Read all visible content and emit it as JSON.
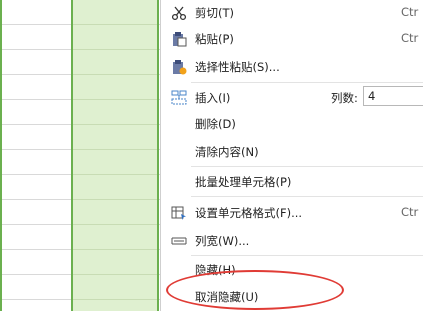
{
  "context_menu": {
    "items": [
      {
        "icon": "scissors-icon",
        "label": "剪切(T)",
        "shortcut": "Ctr"
      },
      {
        "icon": "paste-icon",
        "label": "粘贴(P)",
        "shortcut": "Ctr"
      },
      {
        "icon": "paste-special-icon",
        "label": "选择性粘贴(S)..."
      },
      {
        "icon": "insert-icon",
        "label": "插入(I)",
        "columns_label": "列数:",
        "columns_value": "4"
      },
      {
        "label": "删除(D)"
      },
      {
        "label": "清除内容(N)"
      },
      {
        "label": "批量处理单元格(P)"
      },
      {
        "icon": "format-cells-icon",
        "label": "设置单元格格式(F)...",
        "shortcut": "Ctr"
      },
      {
        "icon": "column-width-icon",
        "label": "列宽(W)..."
      },
      {
        "label": "隐藏(H)"
      },
      {
        "label": "取消隐藏(U)"
      }
    ]
  },
  "colors": {
    "highlight_ellipse": "#e03b35",
    "selected_column": "#dff0d0",
    "column_border": "#6bb04f"
  }
}
